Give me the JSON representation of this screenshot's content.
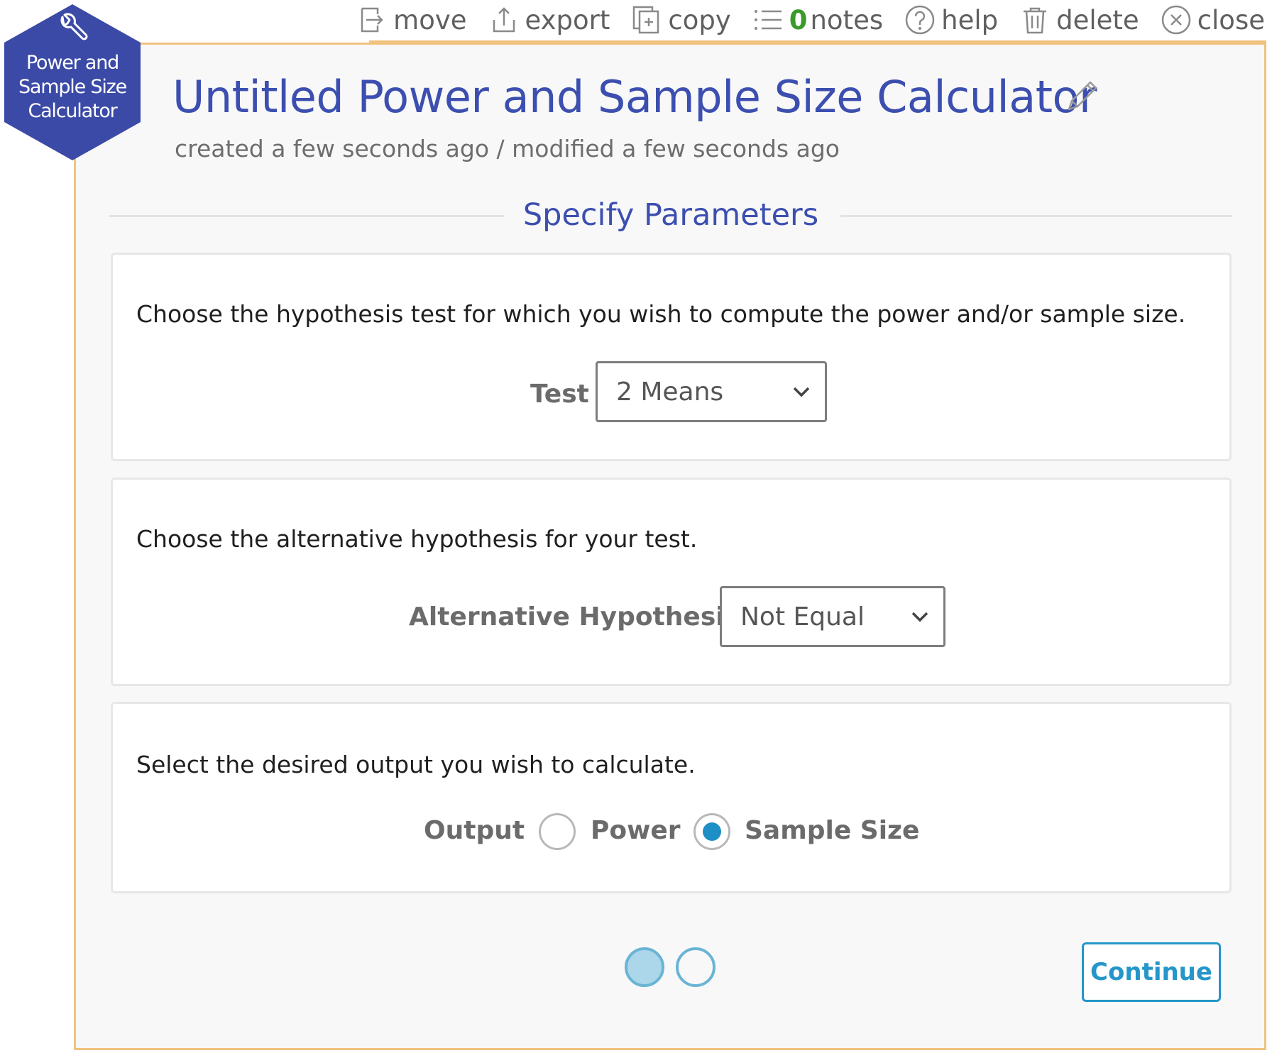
{
  "toolbar": {
    "move": "move",
    "export": "export",
    "copy": "copy",
    "notes_count": "0",
    "notes": "notes",
    "help": "help",
    "delete": "delete",
    "close": "close"
  },
  "badge": {
    "line1": "Power and",
    "line2": "Sample Size",
    "line3": "Calculator",
    "icon": "wrench-icon",
    "color": "#3b4aa6"
  },
  "header": {
    "title": "Untitled Power and Sample Size Calculator",
    "meta": "created a few seconds ago / modified a few seconds ago"
  },
  "section": {
    "title": "Specify Parameters"
  },
  "panels": {
    "test": {
      "prompt": "Choose the hypothesis test for which you wish to compute the power and/or sample size.",
      "label": "Test",
      "value": "2 Means"
    },
    "alternative": {
      "prompt": "Choose the alternative hypothesis for your test.",
      "label": "Alternative Hypothesis",
      "value": "Not Equal"
    },
    "output": {
      "prompt": "Select the desired output you wish to calculate.",
      "label": "Output",
      "options": [
        {
          "label": "Power",
          "checked": false
        },
        {
          "label": "Sample Size",
          "checked": true
        }
      ]
    }
  },
  "footer": {
    "pages": 2,
    "current_page": 1,
    "continue_label": "Continue"
  },
  "colors": {
    "accent_blue": "#3c4fb0",
    "frame_border": "#f0c27e",
    "action_blue": "#2596c9",
    "notes_green": "#3a9a2a"
  }
}
